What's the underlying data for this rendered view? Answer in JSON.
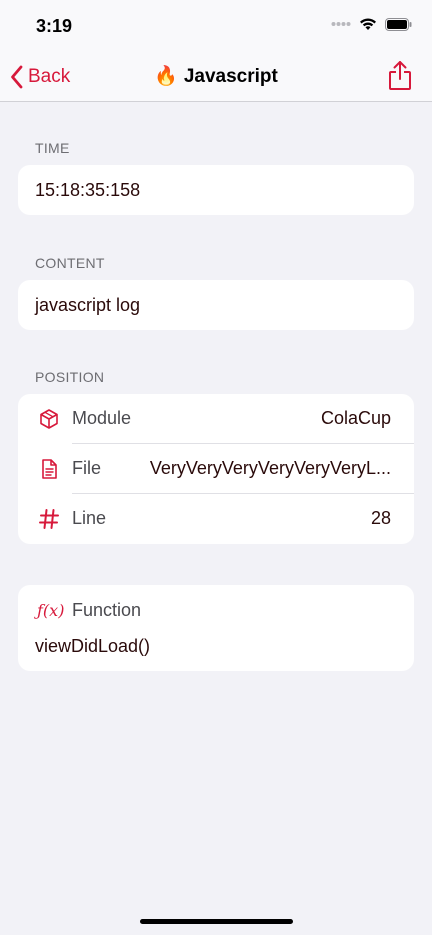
{
  "status_bar": {
    "time": "3:19"
  },
  "nav": {
    "back_label": "Back",
    "title_emoji": "🔥",
    "title": "Javascript"
  },
  "sections": {
    "time": {
      "header": "TIME",
      "value": "15:18:35:158"
    },
    "content": {
      "header": "CONTENT",
      "value": "javascript log"
    },
    "position": {
      "header": "POSITION",
      "rows": [
        {
          "icon": "cube-icon",
          "label": "Module",
          "value": "ColaCup"
        },
        {
          "icon": "document-icon",
          "label": "File",
          "value": "VeryVeryVeryVeryVeryVeryL..."
        },
        {
          "icon": "number-sign-icon",
          "label": "Line",
          "value": "28"
        }
      ]
    },
    "function": {
      "icon": "function-icon",
      "icon_text": "ƒ(x)",
      "label": "Function",
      "value": "viewDidLoad()"
    }
  },
  "colors": {
    "accent": "#d7193b",
    "background": "#f2f2f7",
    "card": "#ffffff"
  }
}
